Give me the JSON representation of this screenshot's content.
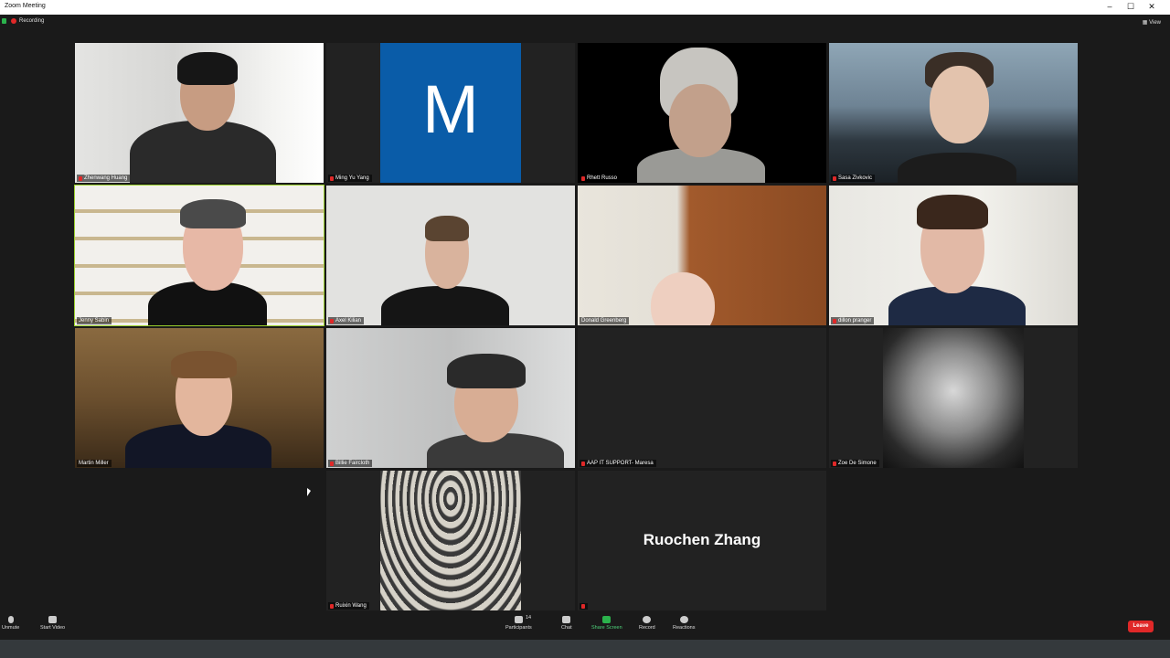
{
  "window": {
    "title": "Zoom Meeting",
    "minimize": "–",
    "maximize": "☐",
    "close": "✕"
  },
  "status": {
    "recording": "Recording"
  },
  "view": {
    "label": "View"
  },
  "participants": [
    {
      "name": "Zhenwang Huang"
    },
    {
      "name": "Ming Yu Yang",
      "avatar_letter": "M"
    },
    {
      "name": "Rhett Russo"
    },
    {
      "name": "Sasa Zivkovic"
    },
    {
      "name": "Jenny Sabin"
    },
    {
      "name": "Axel Kilian"
    },
    {
      "name": "Donald Greenberg"
    },
    {
      "name": "dillon pranger"
    },
    {
      "name": "Martin Miller"
    },
    {
      "name": "Billie Faircloth"
    },
    {
      "name": "AAP IT SUPPORT- Maresa"
    },
    {
      "name": "Zoe De Simone"
    },
    {
      "name": "Ruixin Wang"
    },
    {
      "name": "Ruochen Zhang"
    }
  ],
  "toolbar": {
    "unmute": "Unmute",
    "start_video": "Start Video",
    "participants": "Participants",
    "participants_count": "14",
    "chat": "Chat",
    "share_screen": "Share Screen",
    "record": "Record",
    "reactions": "Reactions",
    "leave": "Leave"
  },
  "colors": {
    "accent_green": "#2bb24c",
    "leave_red": "#e02828",
    "active_speaker": "#9bd12c",
    "avatar_blue": "#0a5ca8"
  }
}
